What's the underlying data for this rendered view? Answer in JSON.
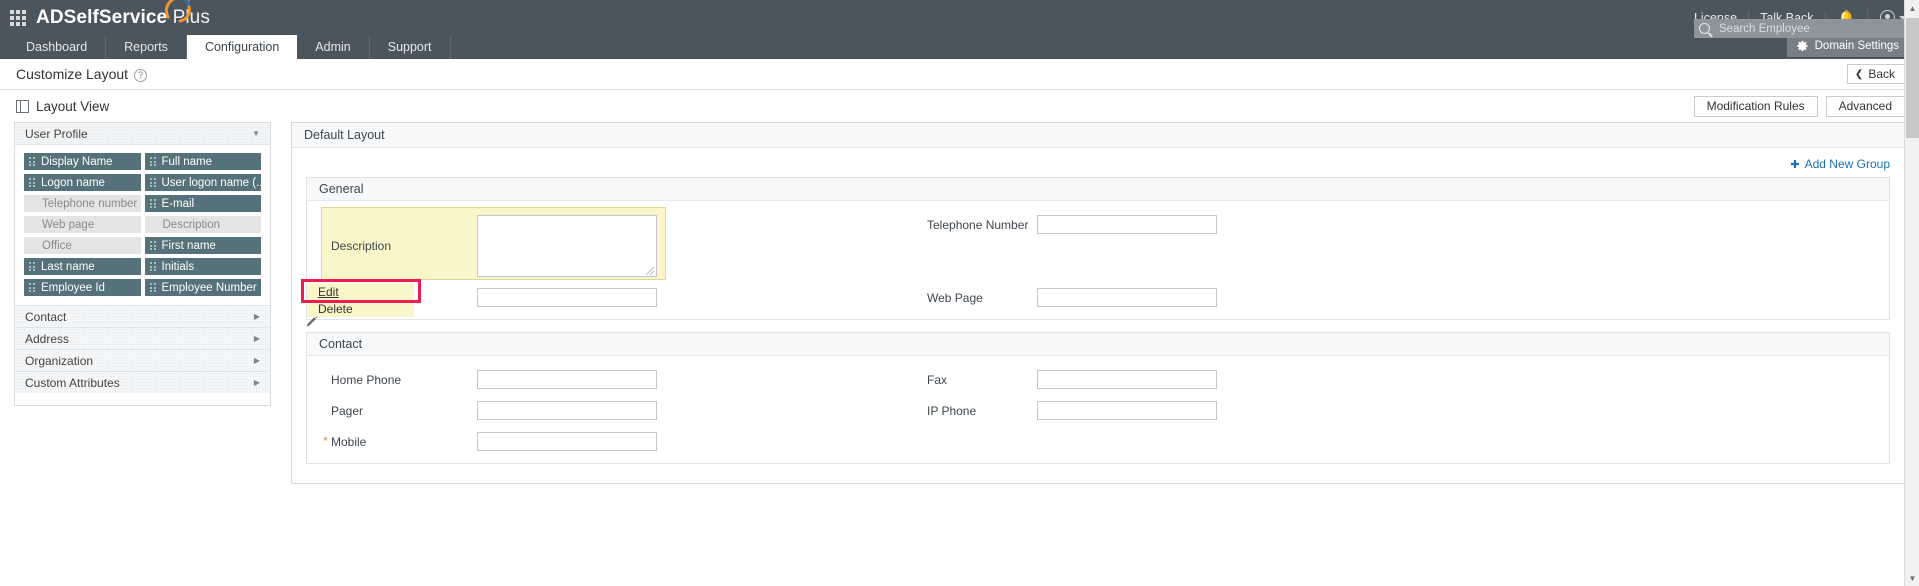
{
  "topbar": {
    "brand_bold": "ADSelfService",
    "brand_light": " Plus",
    "license": "License",
    "talkback": "Talk Back",
    "bell_icon": "notification-bell-icon",
    "user_icon": "user-avatar-icon"
  },
  "search": {
    "placeholder": "Search Employee",
    "value": "",
    "icon": "search-icon"
  },
  "nav": {
    "tabs": [
      {
        "label": "Dashboard",
        "active": false
      },
      {
        "label": "Reports",
        "active": false
      },
      {
        "label": "Configuration",
        "active": true
      },
      {
        "label": "Admin",
        "active": false
      },
      {
        "label": "Support",
        "active": false
      }
    ],
    "domain_settings": "Domain Settings",
    "domain_settings_icon": "gear-icon"
  },
  "page": {
    "title": "Customize Layout",
    "help_icon": "help-question-icon",
    "back_label": "Back",
    "back_icon": "chevron-left-icon"
  },
  "section": {
    "title": "Layout View",
    "icon": "layout-view-icon",
    "buttons": [
      {
        "label": "Modification Rules"
      },
      {
        "label": "Advanced"
      }
    ]
  },
  "sidebar": {
    "header": {
      "label": "User Profile",
      "arrow_icon": "chevron-down-icon"
    },
    "chips": [
      {
        "label": "Display Name",
        "state": "used"
      },
      {
        "label": "Full name",
        "state": "used"
      },
      {
        "label": "Logon name",
        "state": "used"
      },
      {
        "label": "User logon name (...",
        "state": "used"
      },
      {
        "label": "Telephone number",
        "state": "free"
      },
      {
        "label": "E-mail",
        "state": "used"
      },
      {
        "label": "Web page",
        "state": "free"
      },
      {
        "label": "Description",
        "state": "free"
      },
      {
        "label": "Office",
        "state": "free"
      },
      {
        "label": "First name",
        "state": "used"
      },
      {
        "label": "Last name",
        "state": "used"
      },
      {
        "label": "Initials",
        "state": "used"
      },
      {
        "label": "Employee Id",
        "state": "used"
      },
      {
        "label": "Employee Number",
        "state": "used"
      }
    ],
    "accordions": [
      {
        "label": "Contact",
        "arrow_icon": "chevron-right-icon"
      },
      {
        "label": "Address",
        "arrow_icon": "chevron-right-icon"
      },
      {
        "label": "Organization",
        "arrow_icon": "chevron-right-icon"
      },
      {
        "label": "Custom Attributes",
        "arrow_icon": "chevron-right-icon"
      }
    ]
  },
  "main": {
    "panel_title": "Default Layout",
    "add_new_group": "Add New Group",
    "add_new_group_icon": "plus-icon",
    "groups": [
      {
        "title": "General",
        "left_fields": [
          {
            "label": "Description",
            "type": "textarea",
            "value": "",
            "required": false,
            "highlighted": true
          },
          {
            "label": "",
            "type": "input",
            "value": "",
            "required": false,
            "highlighted": false
          }
        ],
        "right_fields": [
          {
            "label": "Telephone Number",
            "type": "input",
            "value": "",
            "required": false
          },
          {
            "label": "Web Page",
            "type": "input",
            "value": "",
            "required": false
          }
        ]
      },
      {
        "title": "Contact",
        "left_fields": [
          {
            "label": "Home Phone",
            "type": "input",
            "value": "",
            "required": false
          },
          {
            "label": "Pager",
            "type": "input",
            "value": "",
            "required": false
          },
          {
            "label": "Mobile",
            "type": "input",
            "value": "",
            "required": true
          }
        ],
        "right_fields": [
          {
            "label": "Fax",
            "type": "input",
            "value": "",
            "required": false
          },
          {
            "label": "IP Phone",
            "type": "input",
            "value": "",
            "required": false
          }
        ]
      }
    ],
    "context_menu": {
      "items": [
        {
          "label": "Edit",
          "selected": true
        },
        {
          "label": "Delete",
          "selected": false
        }
      ],
      "pencil_icon": "pencil-edit-icon",
      "highlight_color": "#ec1d52"
    }
  },
  "colors": {
    "topbar_bg": "#4a555e",
    "chip_used": "#55727a",
    "chip_free": "#e4e4e4",
    "highlight_yellow": "#fbf6c9",
    "accent_link": "#1a6fb5",
    "selection_red": "#ec1d52"
  }
}
